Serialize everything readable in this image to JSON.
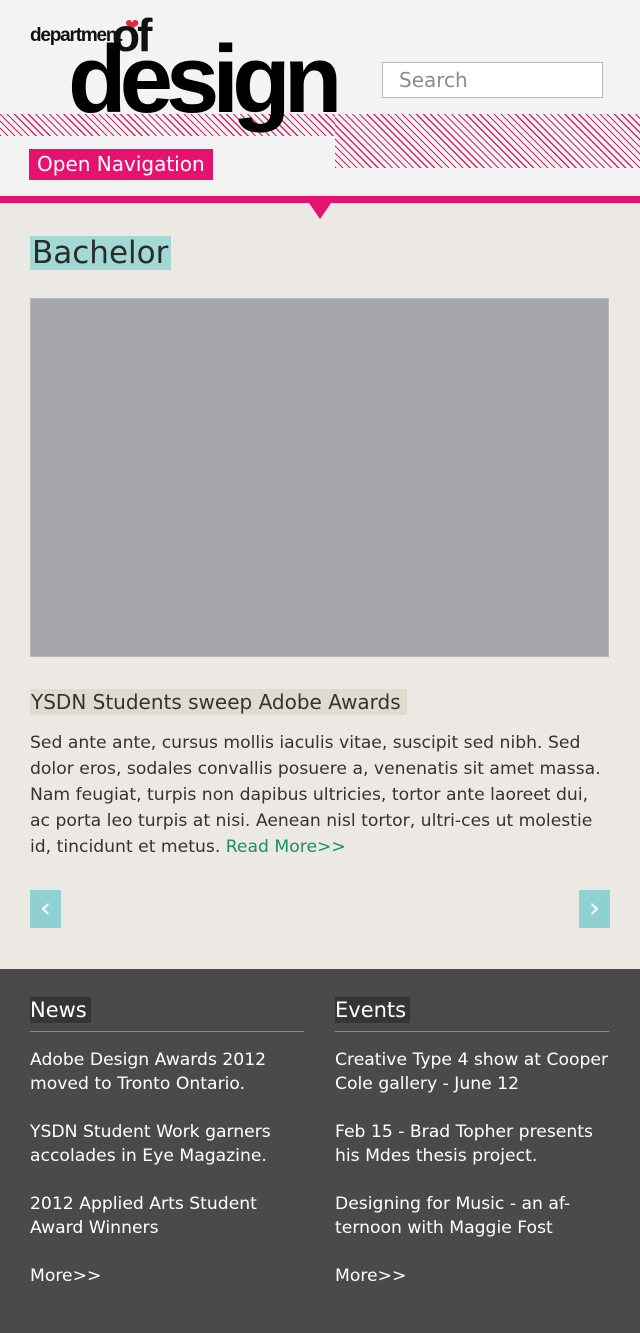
{
  "header": {
    "logo": {
      "line1": "department",
      "line2": "of",
      "line3": "design"
    },
    "search_placeholder": "Search",
    "open_nav_label": "Open Navigation",
    "accent_color": "#e5126f"
  },
  "main": {
    "section_title": "Bachelor",
    "article": {
      "title": "YSDN Students sweep Adobe Awards",
      "body": "Sed ante ante, cursus mollis iaculis vitae, suscipit sed nibh. Sed dolor eros, sodales convallis posuere a, venenatis sit amet massa. Nam feugiat, turpis non dapibus ultricies, tortor ante laoreet dui, ac porta leo turpis at nisi. Aenean nisl tortor, ultri-ces ut molestie id, tincidunt et metus.",
      "read_more": "Read More>>"
    },
    "prev_icon": "‹",
    "next_icon": "›",
    "highlight_color": "#a3d9d5"
  },
  "footer": {
    "news": {
      "title": "News",
      "items": [
        "Adobe Design Awards 2012 moved to Tronto Ontario.",
        "YSDN Student Work garners accolades in Eye Magazine.",
        "2012 Applied Arts Student Award Winners"
      ],
      "more": "More>>"
    },
    "events": {
      "title": "Events",
      "items": [
        "Creative Type 4 show at Cooper Cole gallery - June 12",
        "Feb 15 - Brad Topher presents his Mdes thesis project.",
        "Designing for Music - an af-ternoon with Maggie Fost"
      ],
      "more": "More>>"
    }
  }
}
